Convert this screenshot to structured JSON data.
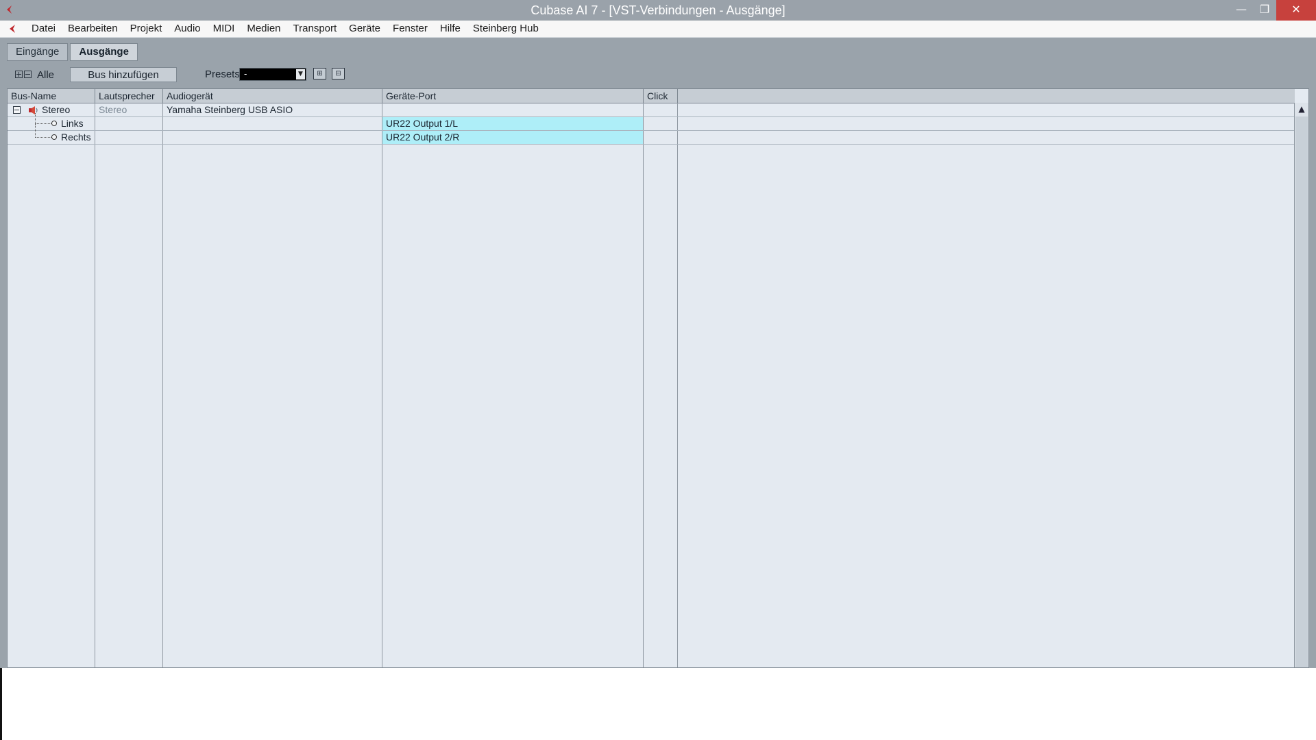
{
  "window": {
    "title": "Cubase AI 7 - [VST-Verbindungen - Ausgänge]",
    "controls": {
      "minimize": "—",
      "maximize": "❐",
      "close": "✕"
    }
  },
  "menu": {
    "items": [
      "Datei",
      "Bearbeiten",
      "Projekt",
      "Audio",
      "MIDI",
      "Medien",
      "Transport",
      "Geräte",
      "Fenster",
      "Hilfe",
      "Steinberg Hub"
    ]
  },
  "tabs": [
    {
      "label": "Eingänge",
      "active": false
    },
    {
      "label": "Ausgänge",
      "active": true
    }
  ],
  "toolbar": {
    "all_label": "Alle",
    "add_bus_label": "Bus hinzufügen",
    "presets_label": "Presets",
    "presets_value": "-"
  },
  "table": {
    "headers": [
      "Bus-Name",
      "Lautsprecher",
      "Audiogerät",
      "Geräte-Port",
      "Click"
    ],
    "rows": [
      {
        "bus_name": "Stereo",
        "speaker": "Stereo",
        "device": "Yamaha Steinberg USB ASIO",
        "port": "",
        "click": ""
      },
      {
        "bus_name": "Links",
        "speaker": "",
        "device": "",
        "port": "UR22 Output 1/L",
        "click": ""
      },
      {
        "bus_name": "Rechts",
        "speaker": "",
        "device": "",
        "port": "UR22 Output 2/R",
        "click": ""
      }
    ]
  },
  "colors": {
    "port_highlight": "#aeeef8",
    "close_button": "#c7413d",
    "logo_red": "#c0282d"
  }
}
